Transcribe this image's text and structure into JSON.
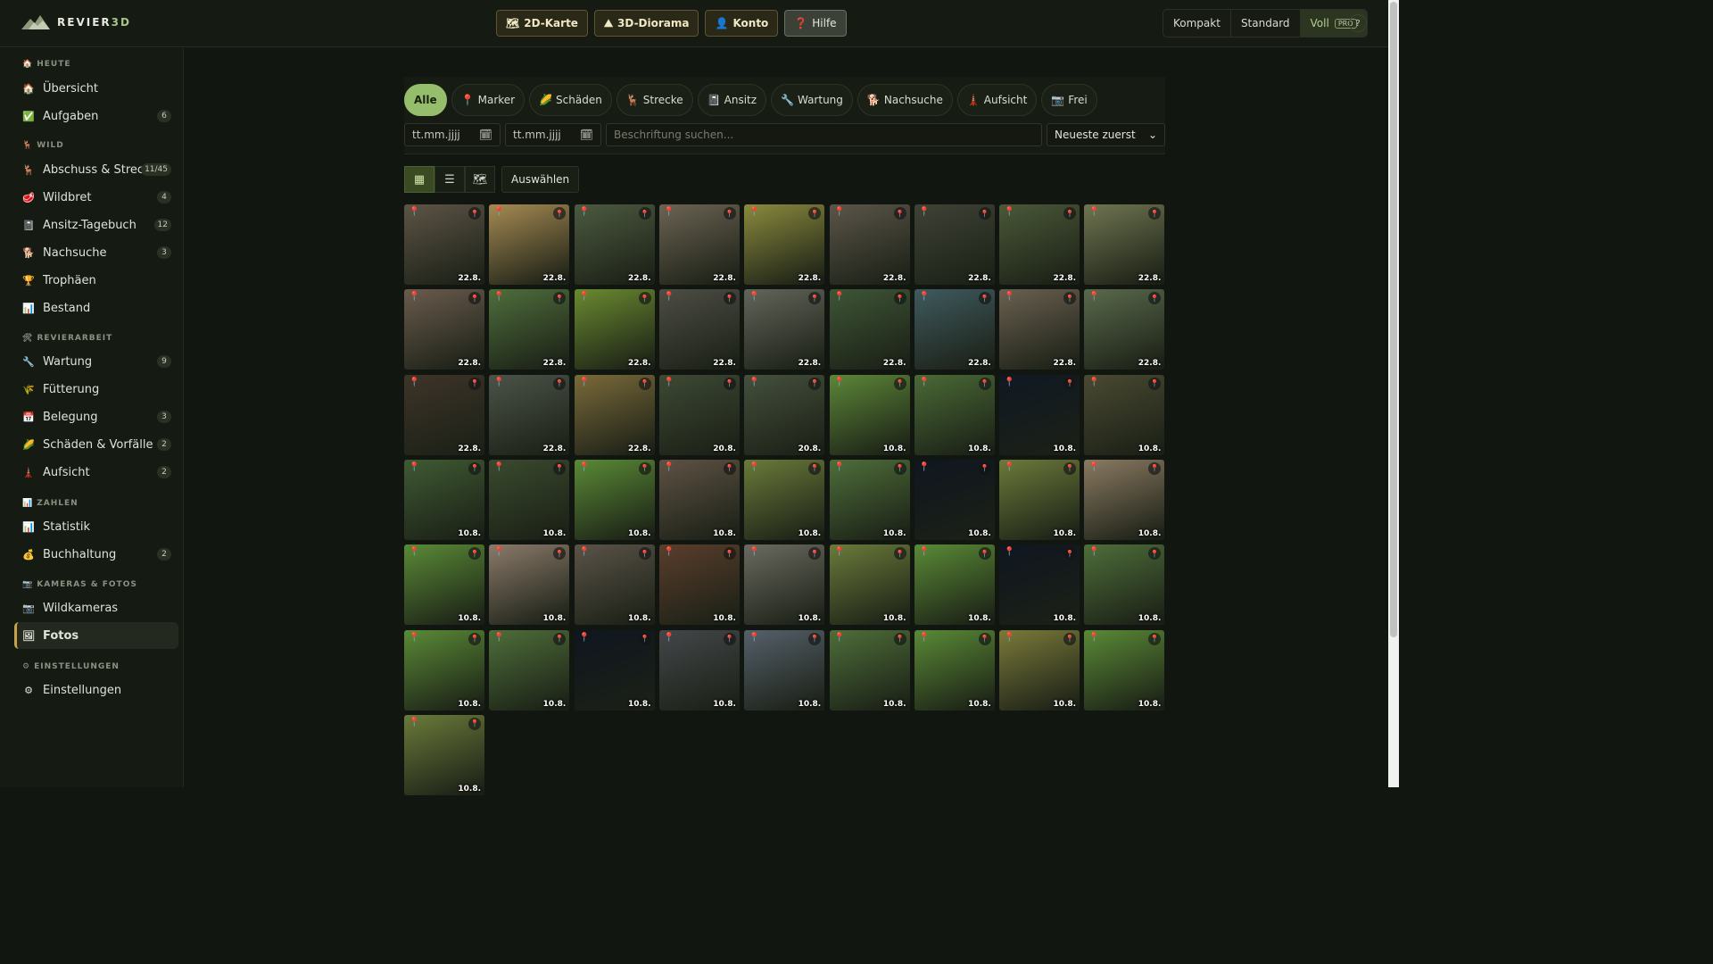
{
  "brand": {
    "name_part1": "REVIER",
    "name_part2": "3D"
  },
  "topnav": [
    {
      "icon": "🗺",
      "label": "2D-Karte",
      "icon_name": "map-icon"
    },
    {
      "icon": "⛰",
      "label": "3D-Diorama",
      "icon_name": "mountain-icon"
    },
    {
      "icon": "👤",
      "label": "Konto",
      "icon_name": "user-icon"
    },
    {
      "icon": "❓",
      "label": "Hilfe",
      "icon_name": "help-icon"
    }
  ],
  "modes": {
    "compact": "Kompakt",
    "standard": "Standard",
    "full": "Voll",
    "pro_badge": "PRO",
    "help": "?"
  },
  "sidebar": {
    "sections": [
      {
        "icon": "🏠",
        "label": "HEUTE"
      },
      {
        "icon": "🦌",
        "label": "WILD"
      },
      {
        "icon": "🛠",
        "label": "REVIERARBEIT"
      },
      {
        "icon": "📊",
        "label": "ZAHLEN"
      },
      {
        "icon": "📷",
        "label": "KAMERAS & FOTOS"
      },
      {
        "icon": "⚙",
        "label": "EINSTELLUNGEN"
      }
    ],
    "items": [
      {
        "icon": "🏠",
        "label": "Übersicht",
        "badge": ""
      },
      {
        "icon": "✅",
        "label": "Aufgaben",
        "badge": "6"
      },
      {
        "icon": "🦌",
        "label": "Abschuss & Strec…",
        "badge": "11/45"
      },
      {
        "icon": "🥩",
        "label": "Wildbret",
        "badge": "4"
      },
      {
        "icon": "📓",
        "label": "Ansitz-Tagebuch",
        "badge": "12"
      },
      {
        "icon": "🐕",
        "label": "Nachsuche",
        "badge": "3"
      },
      {
        "icon": "🏆",
        "label": "Trophäen",
        "badge": ""
      },
      {
        "icon": "📊",
        "label": "Bestand",
        "badge": ""
      },
      {
        "icon": "🔧",
        "label": "Wartung",
        "badge": "9"
      },
      {
        "icon": "🌾",
        "label": "Fütterung",
        "badge": ""
      },
      {
        "icon": "📅",
        "label": "Belegung",
        "badge": "3"
      },
      {
        "icon": "🌽",
        "label": "Schäden & Vorfälle",
        "badge": "2"
      },
      {
        "icon": "🗼",
        "label": "Aufsicht",
        "badge": "2"
      },
      {
        "icon": "📊",
        "label": "Statistik",
        "badge": ""
      },
      {
        "icon": "💰",
        "label": "Buchhaltung",
        "badge": "2"
      },
      {
        "icon": "📷",
        "label": "Wildkameras",
        "badge": ""
      },
      {
        "icon": "🖼",
        "label": "Fotos",
        "badge": ""
      },
      {
        "icon": "⚙",
        "label": "Einstellungen",
        "badge": ""
      }
    ]
  },
  "filters": {
    "chips": [
      {
        "icon": "",
        "label": "Alle"
      },
      {
        "icon": "📍",
        "label": "Marker"
      },
      {
        "icon": "🌽",
        "label": "Schäden"
      },
      {
        "icon": "🦌",
        "label": "Strecke"
      },
      {
        "icon": "📓",
        "label": "Ansitz"
      },
      {
        "icon": "🔧",
        "label": "Wartung"
      },
      {
        "icon": "🐕",
        "label": "Nachsuche"
      },
      {
        "icon": "🗼",
        "label": "Aufsicht"
      },
      {
        "icon": "📷",
        "label": "Frei"
      }
    ],
    "date_from": "tt.mm.jjjj",
    "date_to": "tt.mm.jjjj",
    "search_placeholder": "Beschriftung suchen...",
    "sort": "Neueste zuerst"
  },
  "view": {
    "select_label": "Auswählen"
  },
  "photos": [
    {
      "date": "22.8.",
      "color": "#5d5446"
    },
    {
      "date": "22.8.",
      "color": "#a58a52"
    },
    {
      "date": "22.8.",
      "color": "#4c5a40"
    },
    {
      "date": "22.8.",
      "color": "#6b6353"
    },
    {
      "date": "22.8.",
      "color": "#8a8a3d"
    },
    {
      "date": "22.8.",
      "color": "#5b5549"
    },
    {
      "date": "22.8.",
      "color": "#3f4336"
    },
    {
      "date": "22.8.",
      "color": "#4a5838"
    },
    {
      "date": "22.8.",
      "color": "#6f7550"
    },
    {
      "date": "22.8.",
      "color": "#6a5b4d"
    },
    {
      "date": "22.8.",
      "color": "#4f6e3c"
    },
    {
      "date": "22.8.",
      "color": "#6a8a30"
    },
    {
      "date": "22.8.",
      "color": "#4d4e45"
    },
    {
      "date": "22.8.",
      "color": "#62655a"
    },
    {
      "date": "22.8.",
      "color": "#3e5636"
    },
    {
      "date": "22.8.",
      "color": "#3f5a5e"
    },
    {
      "date": "22.8.",
      "color": "#6a6050"
    },
    {
      "date": "22.8.",
      "color": "#5a6a4c"
    },
    {
      "date": "22.8.",
      "color": "#3e3429"
    },
    {
      "date": "22.8.",
      "color": "#4b5348"
    },
    {
      "date": "22.8.",
      "color": "#7a6a3a"
    },
    {
      "date": "20.8.",
      "color": "#3d4934"
    },
    {
      "date": "20.8.",
      "color": "#45503d"
    },
    {
      "date": "10.8.",
      "color": "#5c8638"
    },
    {
      "date": "10.8.",
      "color": "#4a6a36"
    },
    {
      "date": "10.8.",
      "color": "#101823"
    },
    {
      "date": "10.8.",
      "color": "#4a4a32"
    },
    {
      "date": "10.8.",
      "color": "#3f5a33"
    },
    {
      "date": "10.8.",
      "color": "#3a4a2e"
    },
    {
      "date": "10.8.",
      "color": "#5a8a36"
    },
    {
      "date": "10.8.",
      "color": "#5e5244"
    },
    {
      "date": "10.8.",
      "color": "#6a7a3a"
    },
    {
      "date": "10.8.",
      "color": "#4e6e3a"
    },
    {
      "date": "10.8.",
      "color": "#0f1620"
    },
    {
      "date": "10.8.",
      "color": "#6b7a3a"
    },
    {
      "date": "10.8.",
      "color": "#8a7a62"
    },
    {
      "date": "10.8.",
      "color": "#5a8a36"
    },
    {
      "date": "10.8.",
      "color": "#8a7a6a"
    },
    {
      "date": "10.8.",
      "color": "#5a5348"
    },
    {
      "date": "10.8.",
      "color": "#5a3e2c"
    },
    {
      "date": "10.8.",
      "color": "#6a6a60"
    },
    {
      "date": "10.8.",
      "color": "#6a7a3a"
    },
    {
      "date": "10.8.",
      "color": "#5a8a36"
    },
    {
      "date": "10.8.",
      "color": "#0f1620"
    },
    {
      "date": "10.8.",
      "color": "#4e6e3a"
    },
    {
      "date": "10.8.",
      "color": "#5a8a36"
    },
    {
      "date": "10.8.",
      "color": "#4e6e3a"
    },
    {
      "date": "10.8.",
      "color": "#0f1620"
    },
    {
      "date": "10.8.",
      "color": "#44474a"
    },
    {
      "date": "10.8.",
      "color": "#55606a"
    },
    {
      "date": "10.8.",
      "color": "#4e6e3a"
    },
    {
      "date": "10.8.",
      "color": "#5a8a36"
    },
    {
      "date": "10.8.",
      "color": "#7a7a3a"
    },
    {
      "date": "10.8.",
      "color": "#5a8a36"
    },
    {
      "date": "10.8.",
      "color": "#6a7a3a"
    }
  ]
}
